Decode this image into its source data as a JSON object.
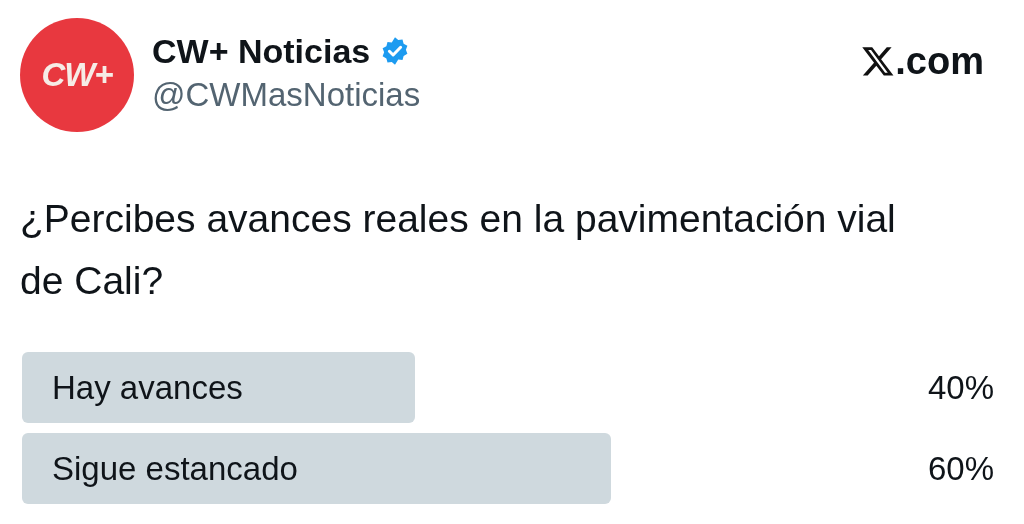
{
  "author": {
    "avatar_text": "CW+",
    "name": "CW+ Noticias",
    "verified": true,
    "handle": "@CWMasNoticias"
  },
  "site": {
    "text": ".com"
  },
  "question": "¿Percibes avances reales en la pavimentación vial de Cali?",
  "poll": [
    {
      "label": "Hay avances",
      "reading": "40%"
    },
    {
      "label": "Sigue estancado",
      "reading": "60%"
    }
  ]
}
